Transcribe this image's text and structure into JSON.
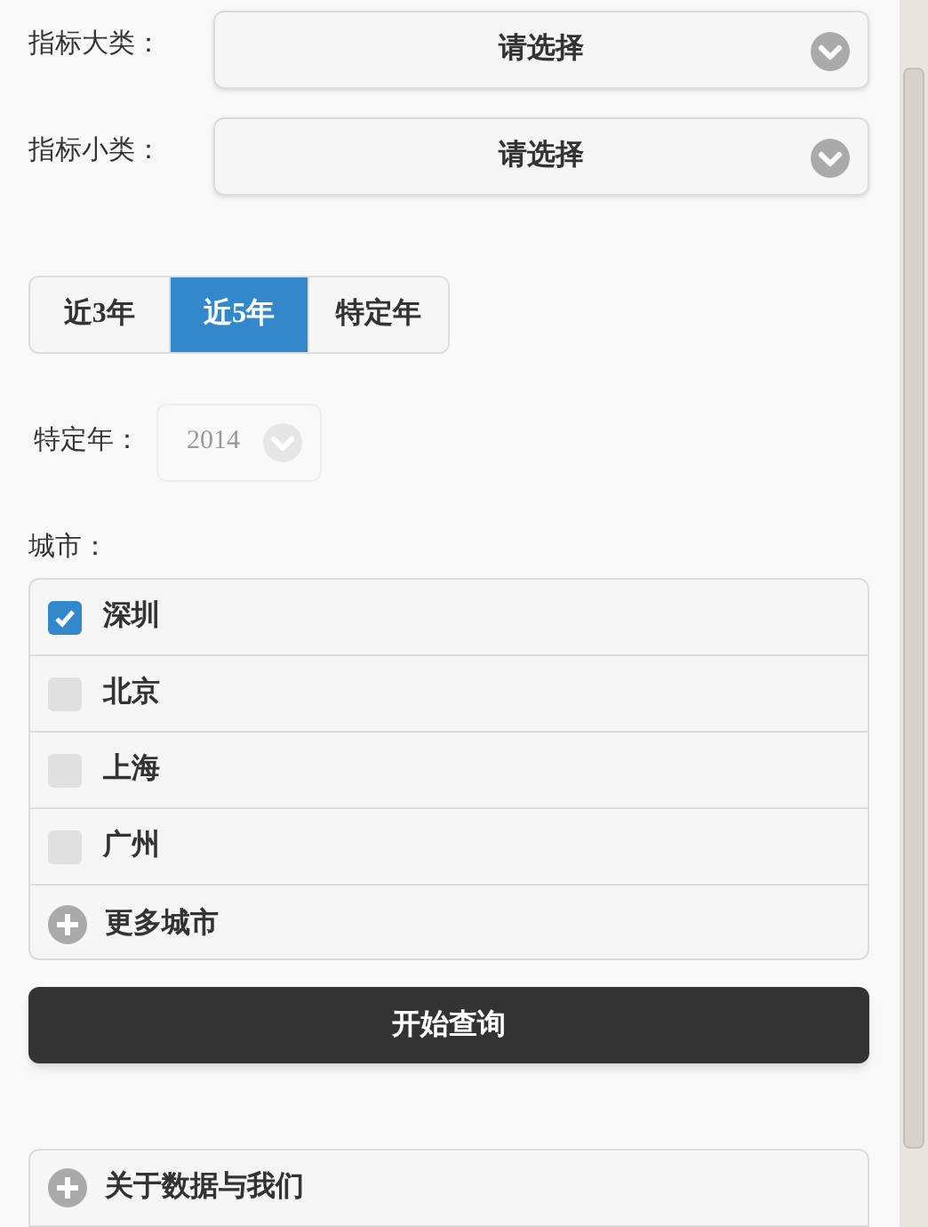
{
  "filters": [
    {
      "label": "指标大类：",
      "value": "请选择"
    },
    {
      "label": "指标小类：",
      "value": "请选择"
    }
  ],
  "range_tabs": [
    {
      "label": "近3年",
      "selected": false
    },
    {
      "label": "近5年",
      "selected": true
    },
    {
      "label": "特定年",
      "selected": false
    }
  ],
  "year_filter": {
    "label": "特定年：",
    "value": "2014",
    "disabled": true
  },
  "city_label": "城市：",
  "cities": [
    {
      "name": "深圳",
      "checked": true
    },
    {
      "name": "北京",
      "checked": false
    },
    {
      "name": "上海",
      "checked": false
    },
    {
      "name": "广州",
      "checked": false
    }
  ],
  "more_cities": {
    "label": "更多城市",
    "expanded": false
  },
  "query_button": "开始查询",
  "about": {
    "label": "关于数据与我们",
    "expanded": false
  }
}
